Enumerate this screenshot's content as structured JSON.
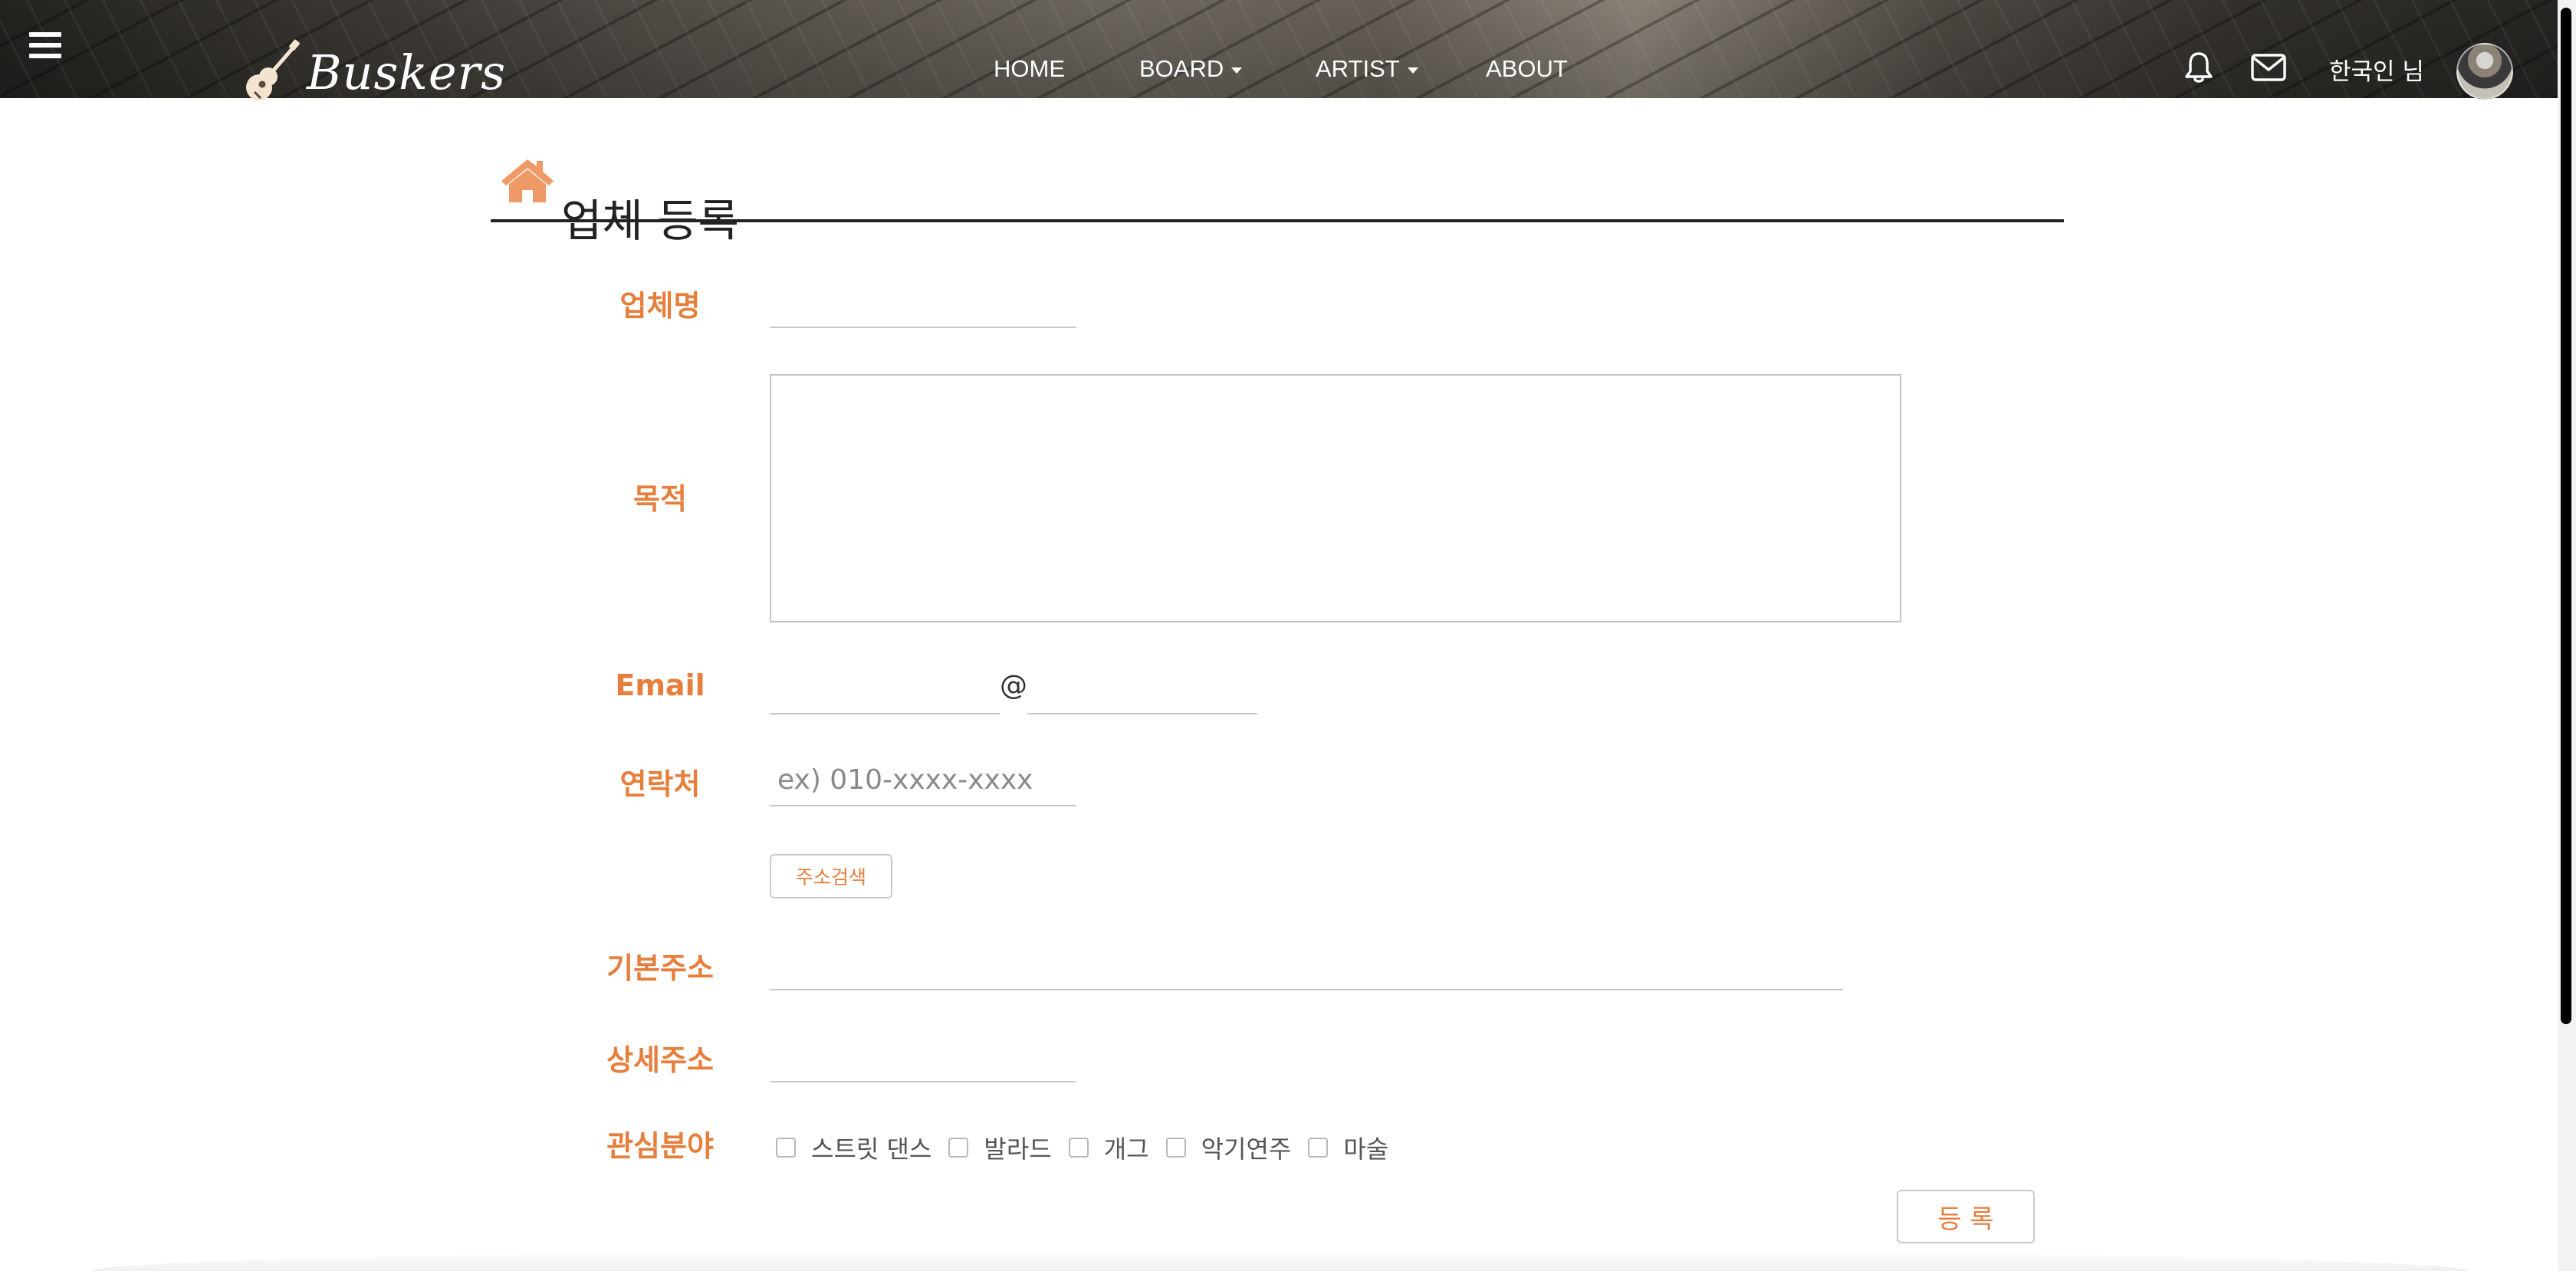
{
  "navbar": {
    "brand": "Buskers",
    "links": [
      {
        "label": "HOME",
        "has_dropdown": false
      },
      {
        "label": "BOARD",
        "has_dropdown": true
      },
      {
        "label": "ARTIST",
        "has_dropdown": true
      },
      {
        "label": "ABOUT",
        "has_dropdown": false
      }
    ],
    "user_name": "한국인 님",
    "icons": [
      "menu-icon",
      "guitar-logo-icon",
      "bell-icon",
      "envelope-icon"
    ]
  },
  "page": {
    "title": "업체 등록",
    "title_icon": "home-icon"
  },
  "form": {
    "company_name": {
      "label": "업체명",
      "value": ""
    },
    "purpose": {
      "label": "목적",
      "value": ""
    },
    "email": {
      "label": "Email",
      "local_value": "",
      "at": "@",
      "domain_value": ""
    },
    "contact": {
      "label": "연락처",
      "placeholder": "ex) 010-xxxx-xxxx",
      "value": ""
    },
    "address_search_button": "주소검색",
    "basic_address": {
      "label": "기본주소",
      "value": ""
    },
    "detail_address": {
      "label": "상세주소",
      "value": ""
    },
    "interests": {
      "label": "관심분야",
      "options": [
        {
          "label": "스트릿 댄스",
          "checked": false
        },
        {
          "label": "발라드",
          "checked": false
        },
        {
          "label": "개그",
          "checked": false
        },
        {
          "label": "악기연주",
          "checked": false
        },
        {
          "label": "마술",
          "checked": false
        }
      ]
    },
    "submit_button": "등 록"
  },
  "colors": {
    "accent": "#e67e3c",
    "title": "#222222",
    "input_border": "#c8c8c8",
    "home_icon": "#ef9966"
  }
}
